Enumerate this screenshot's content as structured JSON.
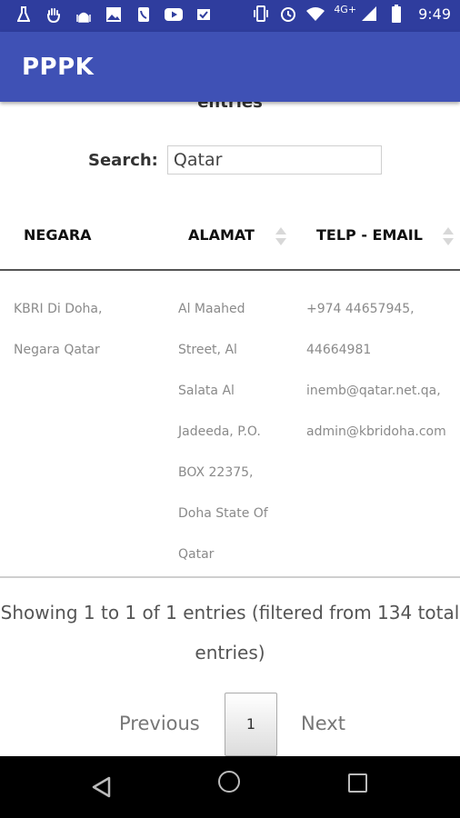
{
  "status_bar": {
    "network": "4G+",
    "time": "9:49",
    "left_icons": [
      "flask-icon",
      "hand-icon",
      "mosque-icon",
      "image-icon",
      "phone-icon",
      "youtube-icon",
      "check-icon"
    ],
    "right_icons": [
      "vibrate-icon",
      "alarm-icon",
      "wifi-icon",
      "signal-icon",
      "battery-icon"
    ]
  },
  "app_bar": {
    "title": "PPPK"
  },
  "table": {
    "cut_text": "entries",
    "search_label": "Search:",
    "search_value": "Qatar",
    "columns": [
      "NEGARA",
      "ALAMAT",
      "TELP - EMAIL"
    ],
    "rows": [
      {
        "negara": [
          "KBRI Di Doha,",
          "Negara Qatar"
        ],
        "alamat": [
          "Al Maahed",
          "Street, Al",
          "Salata Al",
          "Jadeeda, P.O.",
          "BOX 22375,",
          "Doha State Of",
          "Qatar"
        ],
        "telp_email": [
          "+974 44657945,",
          "44664981",
          "inemb@qatar.net.qa,",
          "admin@kbridoha.com"
        ]
      }
    ],
    "info_line1": "Showing 1 to 1 of 1 entries (filtered from 134 total",
    "info_line2": "entries)",
    "pagination": {
      "previous": "Previous",
      "current_page": "1",
      "next": "Next"
    }
  },
  "colors": {
    "status_bar": "#2f3d9e",
    "app_bar": "#3f51b5"
  }
}
